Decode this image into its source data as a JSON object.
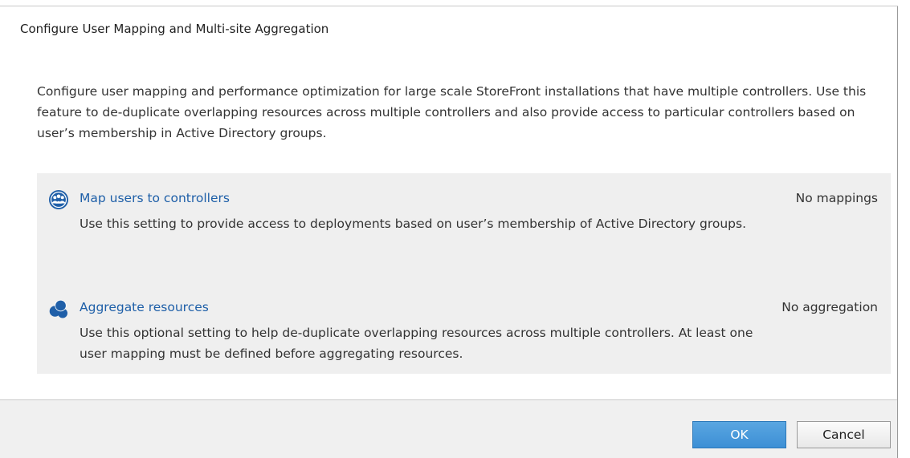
{
  "dialog": {
    "title": "Configure User Mapping and Multi-site Aggregation",
    "description": "Configure user mapping and performance optimization for large scale StoreFront installations that have multiple controllers. Use this feature to de-duplicate overlapping resources across multiple controllers and also provide access to particular controllers based on user’s membership in Active Directory groups."
  },
  "options": [
    {
      "icon": "users-group-icon",
      "link": "Map users to controllers",
      "status": "No mappings",
      "description": "Use this setting to provide access to deployments based on user’s membership of Active Directory groups."
    },
    {
      "icon": "aggregate-resources-icon",
      "link": "Aggregate resources",
      "status": "No aggregation",
      "description": "Use this optional setting to help de-duplicate overlapping resources across multiple controllers. At least one user mapping must be defined before aggregating resources."
    }
  ],
  "footer": {
    "ok_label": "OK",
    "cancel_label": "Cancel"
  },
  "colors": {
    "link": "#1e5fa8",
    "icon": "#1f5fa8",
    "panel_background": "#efefef",
    "ok_button": "#4a9ad9"
  }
}
